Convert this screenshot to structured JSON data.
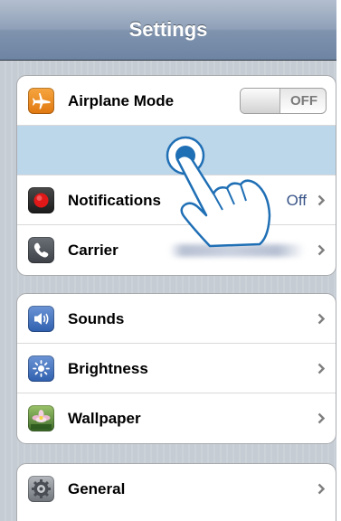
{
  "nav": {
    "title": "Settings"
  },
  "group1": [
    {
      "id": "airplane",
      "label": "Airplane Mode",
      "toggle": "OFF",
      "icon": "airplane-icon",
      "color": "#f08a1c"
    },
    {
      "id": "wifi-blank",
      "label": "",
      "highlighted": true
    },
    {
      "id": "notifications",
      "label": "Notifications",
      "value": "Off",
      "icon": "notifications-icon",
      "color": "#e02020"
    },
    {
      "id": "carrier",
      "label": "Carrier",
      "icon": "phone-icon",
      "color": "#55595f"
    }
  ],
  "group2": [
    {
      "id": "sounds",
      "label": "Sounds",
      "icon": "speaker-icon",
      "color": "#3f6fbf"
    },
    {
      "id": "brightness",
      "label": "Brightness",
      "icon": "sun-icon",
      "color": "#3f6fbf"
    },
    {
      "id": "wallpaper",
      "label": "Wallpaper",
      "icon": "flower-icon",
      "color": "#5a8a3a"
    }
  ],
  "group3": [
    {
      "id": "general",
      "label": "General",
      "icon": "gear-icon",
      "color": "#8c9096"
    }
  ],
  "colors": {
    "highlight": "#bcd6ea",
    "value_text": "#385487",
    "touch": "#1f6fb5"
  }
}
